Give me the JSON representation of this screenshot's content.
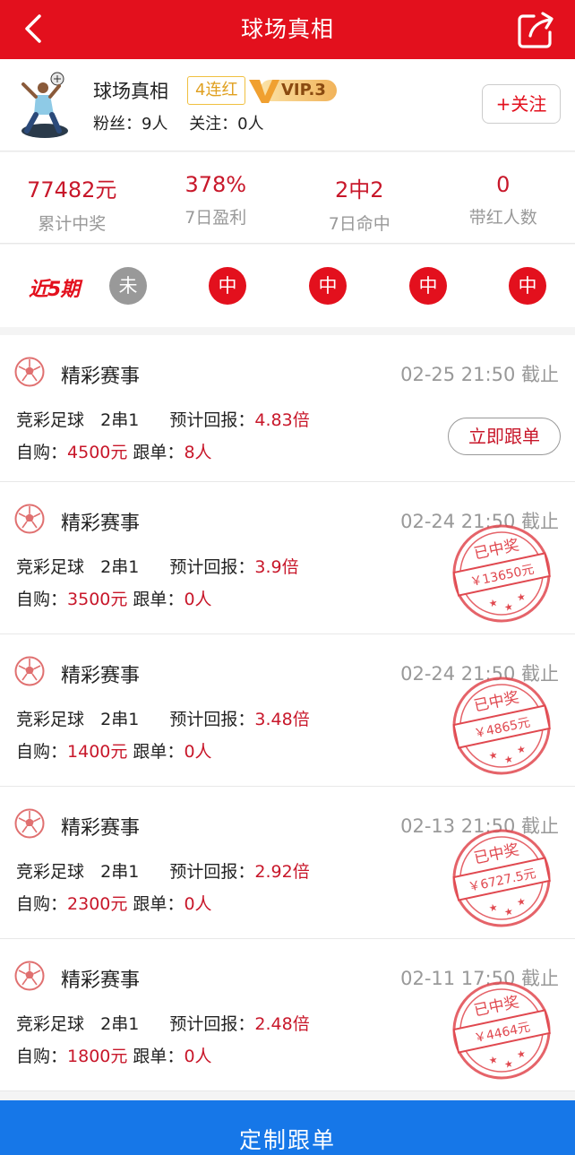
{
  "header": {
    "title": "球场真相",
    "back_icon": "chevron-left-icon",
    "share_icon": "share-icon"
  },
  "profile": {
    "name": "球场真相",
    "streak_badge": "4连红",
    "vip_label": "VIP.3",
    "fans_label": "粉丝：9人",
    "following_label": "关注：0人",
    "follow_button": "+关注"
  },
  "summary": [
    {
      "value": "77482元",
      "label": "累计中奖"
    },
    {
      "value": "378%",
      "label": "7日盈利"
    },
    {
      "value": "2中2",
      "label": "7日命中"
    },
    {
      "value": "0",
      "label": "带红人数"
    }
  ],
  "recent": {
    "label": "近5期",
    "results": [
      {
        "text": "未",
        "status": "pending"
      },
      {
        "text": "中",
        "status": "win"
      },
      {
        "text": "中",
        "status": "win"
      },
      {
        "text": "中",
        "status": "win"
      },
      {
        "text": "中",
        "status": "win"
      }
    ]
  },
  "plans": [
    {
      "title": "精彩赛事",
      "deadline": "02-25 21:50 截止",
      "type": "竞彩足球",
      "pass": "2串1",
      "return_label": "预计回报：",
      "return_value": "4.83倍",
      "buy_label": "自购：",
      "buy_value": "4500元",
      "follow_label": "跟单：",
      "follow_value": "8人",
      "action": "立即跟单",
      "stamp_text": "",
      "stamp_amount": ""
    },
    {
      "title": "精彩赛事",
      "deadline": "02-24 21:50 截止",
      "type": "竞彩足球",
      "pass": "2串1",
      "return_label": "预计回报：",
      "return_value": "3.9倍",
      "buy_label": "自购：",
      "buy_value": "3500元",
      "follow_label": "跟单：",
      "follow_value": "0人",
      "action": "",
      "stamp_text": "已中奖",
      "stamp_amount": "￥13650元"
    },
    {
      "title": "精彩赛事",
      "deadline": "02-24 21:50 截止",
      "type": "竞彩足球",
      "pass": "2串1",
      "return_label": "预计回报：",
      "return_value": "3.48倍",
      "buy_label": "自购：",
      "buy_value": "1400元",
      "follow_label": "跟单：",
      "follow_value": "0人",
      "action": "",
      "stamp_text": "已中奖",
      "stamp_amount": "￥4865元"
    },
    {
      "title": "精彩赛事",
      "deadline": "02-13 21:50 截止",
      "type": "竞彩足球",
      "pass": "2串1",
      "return_label": "预计回报：",
      "return_value": "2.92倍",
      "buy_label": "自购：",
      "buy_value": "2300元",
      "follow_label": "跟单：",
      "follow_value": "0人",
      "action": "",
      "stamp_text": "已中奖",
      "stamp_amount": "￥6727.5元"
    },
    {
      "title": "精彩赛事",
      "deadline": "02-11 17:50 截止",
      "type": "竞彩足球",
      "pass": "2串1",
      "return_label": "预计回报：",
      "return_value": "2.48倍",
      "buy_label": "自购：",
      "buy_value": "1800元",
      "follow_label": "跟单：",
      "follow_value": "0人",
      "action": "",
      "stamp_text": "已中奖",
      "stamp_amount": "￥4464元"
    }
  ],
  "bottom_button": "定制跟单",
  "colors": {
    "primary_red": "#e3101d",
    "value_red": "#c8172a",
    "bottom_blue": "#1677e8",
    "muted": "#999999"
  }
}
